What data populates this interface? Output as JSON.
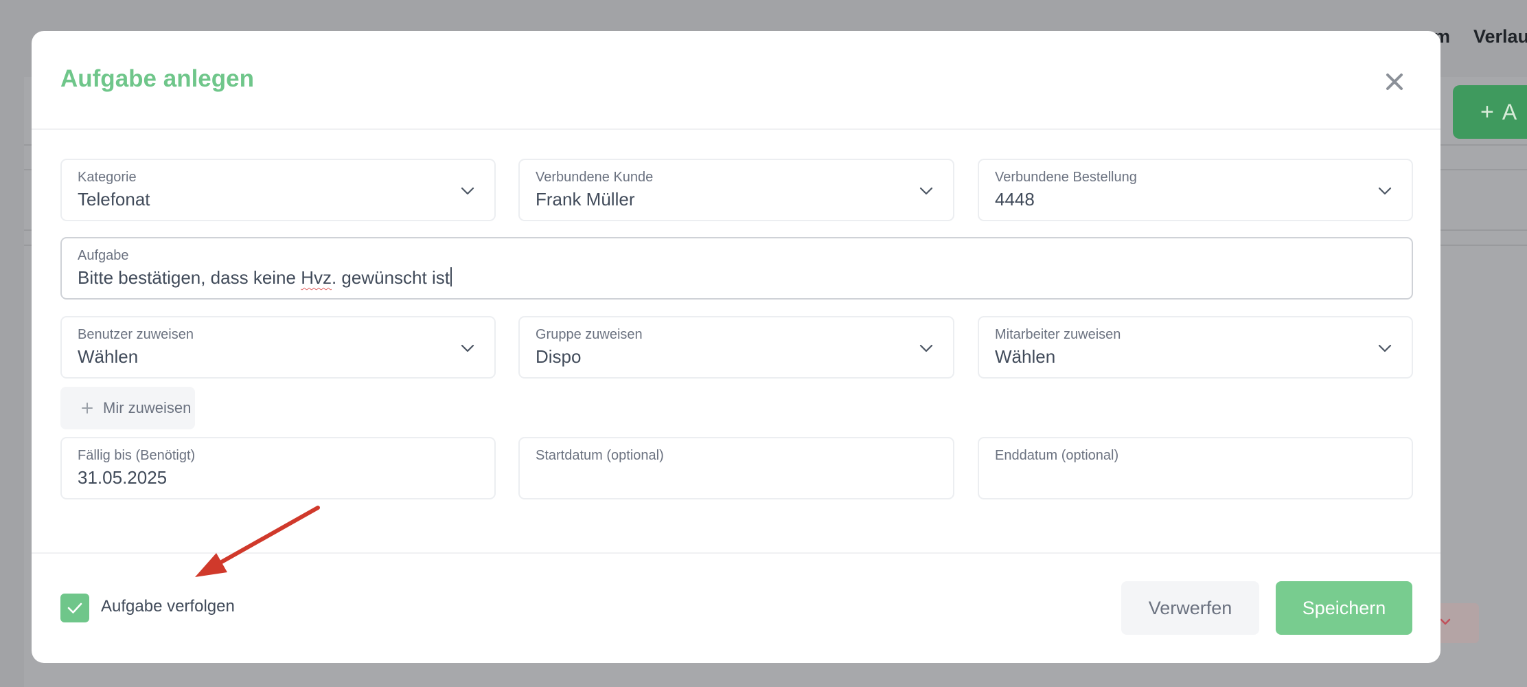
{
  "background": {
    "nav_items": [
      "m",
      "Verlau"
    ],
    "add_button_label": "A"
  },
  "modal": {
    "title": "Aufgabe anlegen",
    "fields": {
      "category": {
        "label": "Kategorie",
        "value": "Telefonat"
      },
      "customer": {
        "label": "Verbundene Kunde",
        "value": "Frank Müller"
      },
      "order": {
        "label": "Verbundene Bestellung",
        "value": "4448"
      },
      "task": {
        "label": "Aufgabe",
        "value_before": "Bitte bestätigen, dass keine ",
        "value_misspelled": "Hvz",
        "value_after": ". gewünscht ist"
      },
      "user": {
        "label": "Benutzer zuweisen",
        "value": "Wählen"
      },
      "group": {
        "label": "Gruppe zuweisen",
        "value": "Dispo"
      },
      "employee": {
        "label": "Mitarbeiter zuweisen",
        "value": "Wählen"
      },
      "due_date": {
        "label": "Fällig bis (Benötigt)",
        "value": "31.05.2025"
      },
      "start_date": {
        "label": "Startdatum (optional)",
        "value": ""
      },
      "end_date": {
        "label": "Enddatum (optional)",
        "value": ""
      }
    },
    "assign_me_label": "Mir zuweisen",
    "follow_task": {
      "label": "Aufgabe verfolgen",
      "checked": true
    },
    "discard_label": "Verwerfen",
    "save_label": "Speichern"
  },
  "colors": {
    "accent": "#6fc68a",
    "save_button": "#78cc8f",
    "annotation_arrow": "#d0392b",
    "overlay": "#a2a3a6"
  },
  "icons": [
    "close-icon",
    "chevron-down-icon",
    "plus-icon",
    "check-icon"
  ]
}
